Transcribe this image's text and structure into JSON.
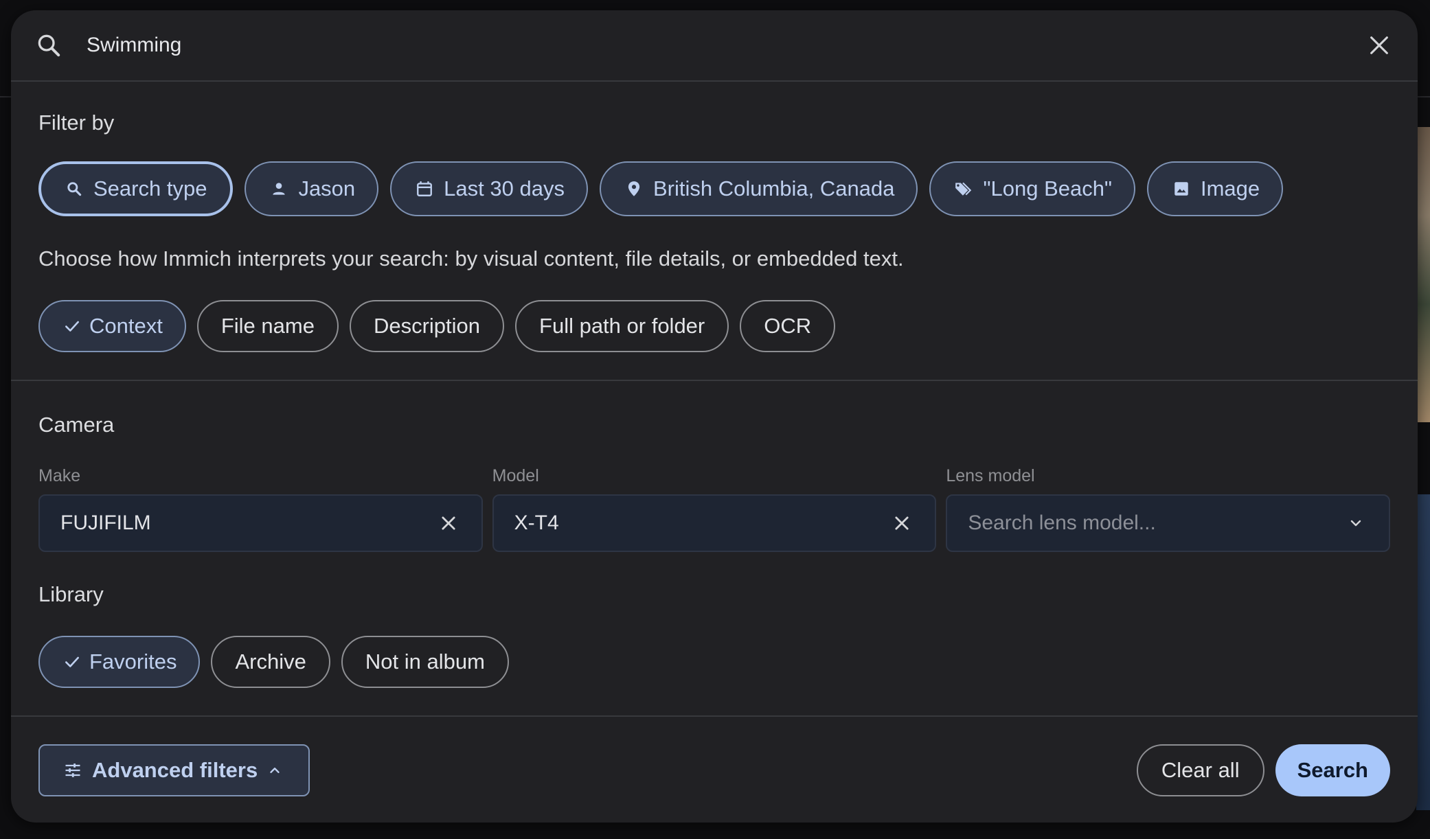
{
  "search": {
    "query": "Swimming"
  },
  "filter": {
    "heading": "Filter by",
    "chips": [
      {
        "label": "Search type",
        "icon": "search-icon"
      },
      {
        "label": "Jason",
        "icon": "person-icon"
      },
      {
        "label": "Last 30 days",
        "icon": "calendar-icon"
      },
      {
        "label": "British Columbia, Canada",
        "icon": "location-pin-icon"
      },
      {
        "label": "\"Long Beach\"",
        "icon": "tag-icon"
      },
      {
        "label": "Image",
        "icon": "image-icon"
      }
    ],
    "description": "Choose how Immich interprets your search: by visual content, file details, or embedded text.",
    "options": [
      {
        "label": "Context",
        "selected": true
      },
      {
        "label": "File name",
        "selected": false
      },
      {
        "label": "Description",
        "selected": false
      },
      {
        "label": "Full path or folder",
        "selected": false
      },
      {
        "label": "OCR",
        "selected": false
      }
    ]
  },
  "camera": {
    "heading": "Camera",
    "make": {
      "label": "Make",
      "value": "FUJIFILM"
    },
    "model": {
      "label": "Model",
      "value": "X-T4"
    },
    "lens": {
      "label": "Lens model",
      "placeholder": "Search lens model..."
    }
  },
  "library": {
    "heading": "Library",
    "options": [
      {
        "label": "Favorites",
        "selected": true
      },
      {
        "label": "Archive",
        "selected": false
      },
      {
        "label": "Not in album",
        "selected": false
      }
    ]
  },
  "footer": {
    "advanced_label": "Advanced filters",
    "clear_label": "Clear all",
    "search_label": "Search"
  },
  "colors": {
    "panel": "#212124",
    "chip_border": "#7f93b4",
    "chip_text": "#bfd0ef",
    "primary_button": "#a8c7fa"
  }
}
